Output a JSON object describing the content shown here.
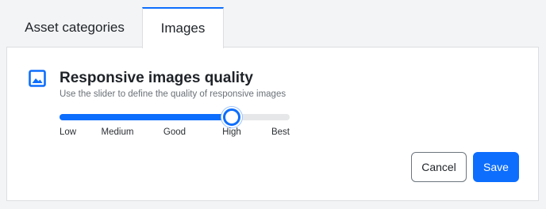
{
  "tabs": [
    {
      "label": "Asset categories",
      "active": false
    },
    {
      "label": "Images",
      "active": true
    }
  ],
  "section": {
    "title": "Responsive images quality",
    "description": "Use the slider to define the quality of responsive images",
    "icon": "image-icon"
  },
  "slider": {
    "options": [
      "Low",
      "Medium",
      "Good",
      "High",
      "Best"
    ],
    "selected": "High",
    "selected_index": 3
  },
  "buttons": {
    "cancel": "Cancel",
    "save": "Save"
  },
  "colors": {
    "accent": "#0d6efd",
    "track": "#e6e7e9",
    "border": "#dcdee1",
    "background": "#f3f4f5"
  }
}
